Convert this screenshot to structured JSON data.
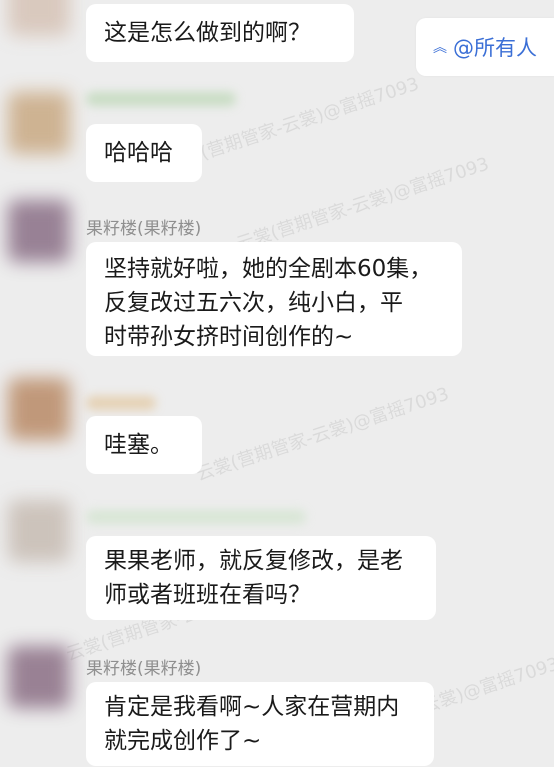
{
  "mention_button": {
    "arrow_icon": "double-chevron-up-icon",
    "label": "@所有人"
  },
  "messages": [
    {
      "text": "这是怎么做到的啊？"
    },
    {
      "text": "哈哈哈"
    },
    {
      "sender": "果籽楼(果籽楼)",
      "text": "坚持就好啦，她的全剧本60集，\n反复改过五六次，纯小白，平\n时带孙女挤时间创作的~"
    },
    {
      "text": "哇塞。"
    },
    {
      "text": "果果老师，就反复修改，是老\n师或者班班在看吗？"
    },
    {
      "sender": "果籽楼(果籽楼)",
      "text": "肯定是我看啊~人家在营期内\n就完成创作了~"
    }
  ],
  "watermark": "云裳(营期管家-云裳)@富摇7093"
}
